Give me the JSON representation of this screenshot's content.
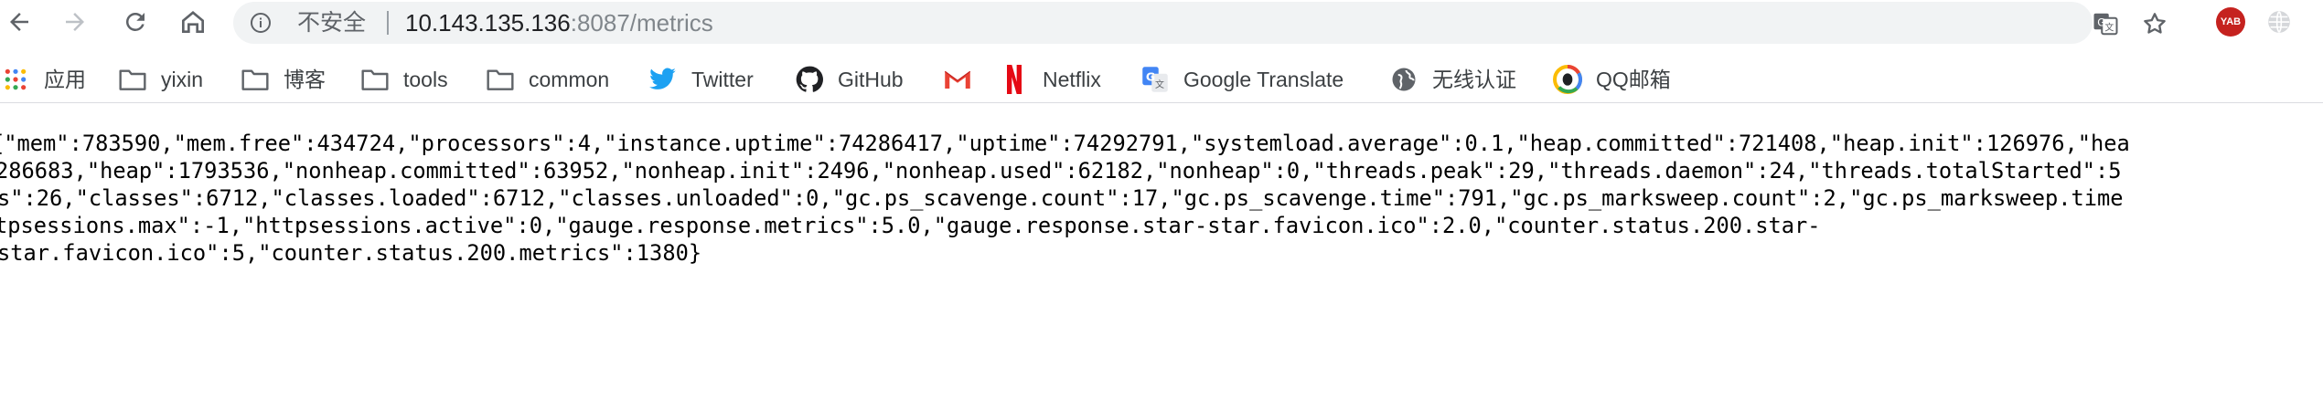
{
  "browser": {
    "security_label": "不安全",
    "url_host": "10.143.135.136",
    "url_rest": ":8087/metrics",
    "avatar_text": "YAB"
  },
  "bookmarks": [
    {
      "label": "应用",
      "icon": "apps-grid-icon"
    },
    {
      "label": "yixin",
      "icon": "folder-icon"
    },
    {
      "label": "博客",
      "icon": "folder-icon"
    },
    {
      "label": "tools",
      "icon": "folder-icon"
    },
    {
      "label": "common",
      "icon": "folder-icon"
    },
    {
      "label": "Twitter",
      "icon": "twitter-icon"
    },
    {
      "label": "GitHub",
      "icon": "github-icon"
    },
    {
      "label": "",
      "icon": "gmail-icon"
    },
    {
      "label": "Netflix",
      "icon": "netflix-icon"
    },
    {
      "label": "Google Translate",
      "icon": "google-translate-icon"
    },
    {
      "label": "无线认证",
      "icon": "globe-icon"
    },
    {
      "label": "QQ邮箱",
      "icon": "qq-mail-icon"
    }
  ],
  "content": {
    "lines": [
      "{\"mem\":783590,\"mem.free\":434724,\"processors\":4,\"instance.uptime\":74286417,\"uptime\":74292791,\"systemload.average\":0.1,\"heap.committed\":721408,\"heap.init\":126976,\"hea",
      "286683,\"heap\":1793536,\"nonheap.committed\":63952,\"nonheap.init\":2496,\"nonheap.used\":62182,\"nonheap\":0,\"threads.peak\":29,\"threads.daemon\":24,\"threads.totalStarted\":5",
      "s\":26,\"classes\":6712,\"classes.loaded\":6712,\"classes.unloaded\":0,\"gc.ps_scavenge.count\":17,\"gc.ps_scavenge.time\":791,\"gc.ps_marksweep.count\":2,\"gc.ps_marksweep.time",
      "tpsessions.max\":-1,\"httpsessions.active\":0,\"gauge.response.metrics\":5.0,\"gauge.response.star-star.favicon.ico\":2.0,\"counter.status.200.star-",
      "star.favicon.ico\":5,\"counter.status.200.metrics\":1380}"
    ]
  }
}
